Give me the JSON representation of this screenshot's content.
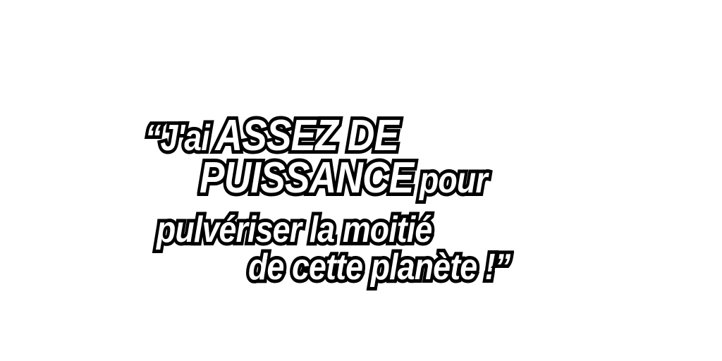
{
  "quote": {
    "line1": {
      "open_quote": "“",
      "small": "J'ai",
      "big": "ASSEZ DE"
    },
    "line2": {
      "big": "PUISSANCE",
      "small": "pour"
    },
    "line3": {
      "small": "pulvériser la moitié"
    },
    "line4": {
      "small": "de cette planète !",
      "close_quote": "”"
    }
  },
  "colors": {
    "text_fill": "#ffffff",
    "text_outline": "#000000",
    "background": "#ffffff"
  }
}
